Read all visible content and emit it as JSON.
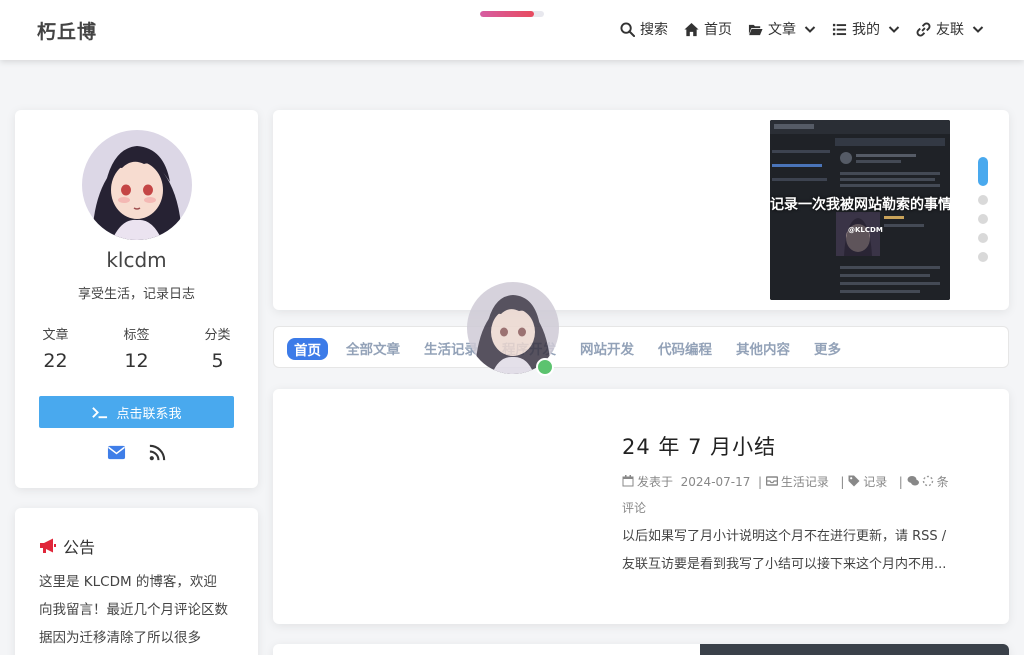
{
  "site": {
    "logo": "朽丘博"
  },
  "reading_progress": 0.85,
  "nav": {
    "search": "搜索",
    "home": "首页",
    "articles": "文章",
    "mine": "我的",
    "links": "友联"
  },
  "profile": {
    "name": "klcdm",
    "motto": "享受生活，记录日志",
    "stats": [
      {
        "label": "文章",
        "value": "22"
      },
      {
        "label": "标签",
        "value": "12"
      },
      {
        "label": "分类",
        "value": "5"
      }
    ],
    "contact_label": "点击联系我"
  },
  "notice": {
    "title": "公告",
    "text": "这里是 KLCDM 的博客，欢迎向我留言！最近几个月评论区数据因为迁移清除了所以很多"
  },
  "slider": {
    "caption": "记录一次我被网站勒索的事情",
    "watermark": "@KLCDM",
    "active_index": 0,
    "count": 5
  },
  "tabs": [
    "首页",
    "全部文章",
    "生活记录",
    "程序开发",
    "网站开发",
    "代码编程",
    "其他内容",
    "更多"
  ],
  "post": {
    "title": "24 年 7 月小结",
    "published_label": "发表于",
    "date": "2024-07-17",
    "category": "生活记录",
    "tag": "记录",
    "comments_suffix": "条",
    "comments_word": "评论",
    "excerpt_line1": "以后如果写了月小计说明这个月不在进行更新，请 RSS /",
    "excerpt_line2": "友联互访要是看到我写了小结可以接下来这个月内不用..."
  },
  "colors": {
    "accent": "#49a9ee",
    "tab_active": "#3c7be8",
    "tab_text": "#93a2b8",
    "notice_icon": "#e0263a",
    "online": "#5cc36f"
  }
}
